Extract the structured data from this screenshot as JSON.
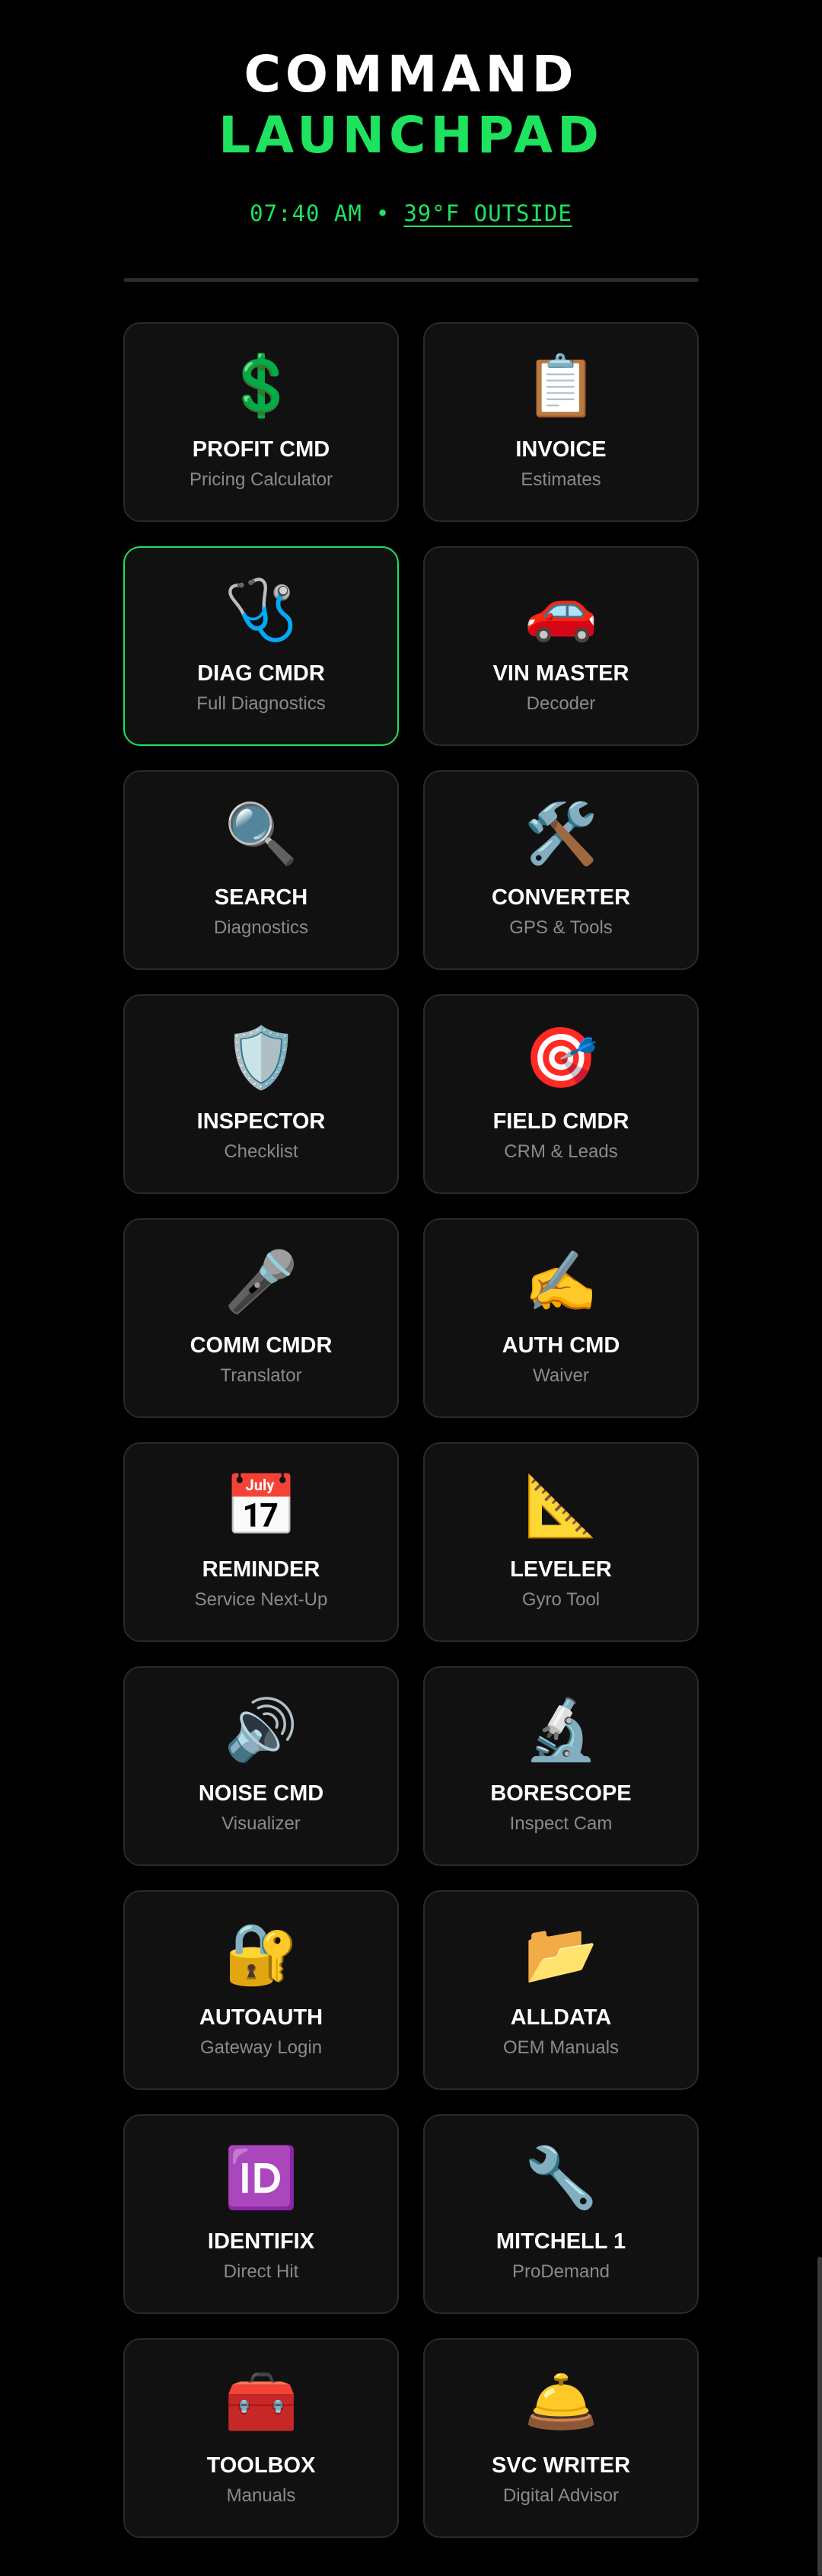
{
  "header": {
    "title_line1": "COMMAND",
    "title_line2": "LAUNCHPAD",
    "time": "07:40 AM",
    "separator": "•",
    "weather": "39°F OUTSIDE"
  },
  "colors": {
    "background": "#000000",
    "accent": "#1ee35f",
    "card": "#111111",
    "card_border": "#2a2a2a",
    "subtitle": "#8a8a8a"
  },
  "cards": [
    {
      "icon": "💲",
      "icon_name": "dollar-sign-icon",
      "title": "PROFIT CMD",
      "subtitle": "Pricing Calculator",
      "active": false
    },
    {
      "icon": "📋",
      "icon_name": "clipboard-icon",
      "title": "INVOICE",
      "subtitle": "Estimates",
      "active": false
    },
    {
      "icon": "🩺",
      "icon_name": "stethoscope-icon",
      "title": "DIAG CMDR",
      "subtitle": "Full Diagnostics",
      "active": true
    },
    {
      "icon": "🚗",
      "icon_name": "car-icon",
      "title": "VIN MASTER",
      "subtitle": "Decoder",
      "active": false
    },
    {
      "icon": "🔍",
      "icon_name": "magnifier-icon",
      "title": "SEARCH",
      "subtitle": "Diagnostics",
      "active": false
    },
    {
      "icon": "🛠️",
      "icon_name": "hammer-wrench-icon",
      "title": "CONVERTER",
      "subtitle": "GPS & Tools",
      "active": false
    },
    {
      "icon": "🛡️",
      "icon_name": "shield-icon",
      "title": "INSPECTOR",
      "subtitle": "Checklist",
      "active": false
    },
    {
      "icon": "🎯",
      "icon_name": "target-icon",
      "title": "FIELD CMDR",
      "subtitle": "CRM & Leads",
      "active": false
    },
    {
      "icon": "🎤",
      "icon_name": "microphone-icon",
      "title": "COMM CMDR",
      "subtitle": "Translator",
      "active": false
    },
    {
      "icon": "✍️",
      "icon_name": "writing-hand-icon",
      "title": "AUTH CMD",
      "subtitle": "Waiver",
      "active": false
    },
    {
      "icon": "📅",
      "icon_name": "calendar-icon",
      "title": "REMINDER",
      "subtitle": "Service Next-Up",
      "active": false
    },
    {
      "icon": "📐",
      "icon_name": "triangle-ruler-icon",
      "title": "LEVELER",
      "subtitle": "Gyro Tool",
      "active": false
    },
    {
      "icon": "🔊",
      "icon_name": "speaker-icon",
      "title": "NOISE CMD",
      "subtitle": "Visualizer",
      "active": false
    },
    {
      "icon": "🔬",
      "icon_name": "microscope-icon",
      "title": "BORESCOPE",
      "subtitle": "Inspect Cam",
      "active": false
    },
    {
      "icon": "🔐",
      "icon_name": "lock-key-icon",
      "title": "AUTOAUTH",
      "subtitle": "Gateway Login",
      "active": false
    },
    {
      "icon": "📂",
      "icon_name": "folder-icon",
      "title": "ALLDATA",
      "subtitle": "OEM Manuals",
      "active": false
    },
    {
      "icon": "🆔",
      "icon_name": "id-badge-icon",
      "title": "IDENTIFIX",
      "subtitle": "Direct Hit",
      "active": false
    },
    {
      "icon": "🔧",
      "icon_name": "wrench-icon",
      "title": "MITCHELL 1",
      "subtitle": "ProDemand",
      "active": false
    },
    {
      "icon": "🧰",
      "icon_name": "toolbox-icon",
      "title": "TOOLBOX",
      "subtitle": "Manuals",
      "active": false
    },
    {
      "icon": "🛎️",
      "icon_name": "service-bell-icon",
      "title": "SVC WRITER",
      "subtitle": "Digital Advisor",
      "active": false
    }
  ]
}
